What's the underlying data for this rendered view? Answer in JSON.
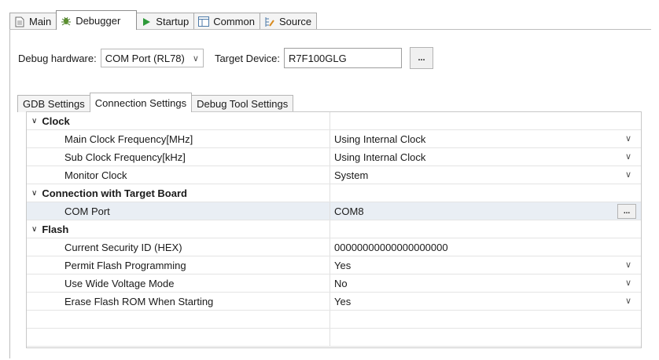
{
  "tabs": [
    {
      "label": "Main",
      "icon": "document-icon"
    },
    {
      "label": "Debugger",
      "icon": "bug-icon"
    },
    {
      "label": "Startup",
      "icon": "play-icon"
    },
    {
      "label": "Common",
      "icon": "window-icon"
    },
    {
      "label": "Source",
      "icon": "source-folder-icon"
    }
  ],
  "hardware": {
    "label": "Debug hardware:",
    "value": "COM Port (RL78)",
    "target_label": "Target Device:",
    "target_value": "R7F100GLG",
    "browse_label": "..."
  },
  "inner_tabs": [
    "GDB Settings",
    "Connection Settings",
    "Debug Tool Settings"
  ],
  "groups": {
    "clock": {
      "label": "Clock",
      "main_clock": {
        "label": "Main Clock Frequency[MHz]",
        "value": "Using Internal Clock"
      },
      "sub_clock": {
        "label": "Sub Clock Frequency[kHz]",
        "value": "Using Internal Clock"
      },
      "monitor_clock": {
        "label": "Monitor Clock",
        "value": "System"
      }
    },
    "connection": {
      "label": "Connection with Target Board",
      "com_port": {
        "label": "COM Port",
        "value": "COM8",
        "button": "..."
      }
    },
    "flash": {
      "label": "Flash",
      "security_id": {
        "label": "Current Security ID (HEX)",
        "value": "00000000000000000000"
      },
      "permit_flash": {
        "label": "Permit Flash Programming",
        "value": "Yes"
      },
      "wide_voltage": {
        "label": "Use Wide Voltage Mode",
        "value": "No"
      },
      "erase_flash": {
        "label": "Erase Flash ROM When Starting",
        "value": "Yes"
      }
    }
  },
  "colors": {
    "selected_row": "#e9eef4",
    "play_icon": "#2e9a3a",
    "bug_icon": "#4a8a2a"
  }
}
